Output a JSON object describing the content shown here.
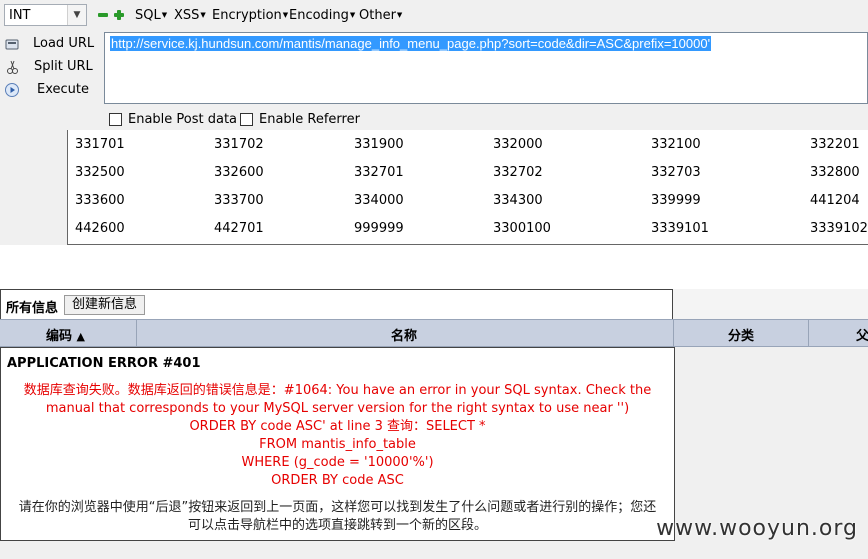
{
  "toolbar": {
    "select_value": "INT",
    "menus": [
      "SQL",
      "XSS",
      "Encryption",
      "Encoding",
      "Other"
    ]
  },
  "actions": {
    "load_url": "Load URL",
    "split_url": "Split URL",
    "execute": "Execute"
  },
  "url": "http://service.kj.hundsun.com/mantis/manage_info_menu_page.php?sort=code&dir=ASC&prefix=10000'",
  "options": {
    "post": "Enable Post data",
    "referrer": "Enable Referrer"
  },
  "codes": [
    [
      "331701",
      "331702",
      "331900",
      "332000",
      "332100",
      "332201"
    ],
    [
      "332500",
      "332600",
      "332701",
      "332702",
      "332703",
      "332800"
    ],
    [
      "333600",
      "333700",
      "334000",
      "334300",
      "339999",
      "441204"
    ],
    [
      "442600",
      "442701",
      "999999",
      "3300100",
      "3339101",
      "3339102"
    ]
  ],
  "panel": {
    "title": "所有信息",
    "create_button": "创建新信息"
  },
  "columns": {
    "code": "编码",
    "name": "名称",
    "category": "分类",
    "parent": "父"
  },
  "error": {
    "heading": "APPLICATION ERROR #401",
    "lines": [
      "数据库查询失败。数据库返回的错误信息是：#1064: You have an error in your SQL syntax. Check the",
      "manual that corresponds to your MySQL server version for the right syntax to use near '')",
      "ORDER BY code ASC' at line 3 查询：SELECT *",
      "FROM mantis_info_table",
      "WHERE (g_code = '10000'%')",
      "ORDER BY code ASC"
    ],
    "hint_lines": [
      "请在你的浏览器中使用“后退”按钮来返回到上一页面，这样您可以找到发生了什么问题或者进行别的操作；您还",
      "可以点击导航栏中的选项直接跳转到一个新的区段。"
    ]
  },
  "watermark": "www.wooyun.org"
}
